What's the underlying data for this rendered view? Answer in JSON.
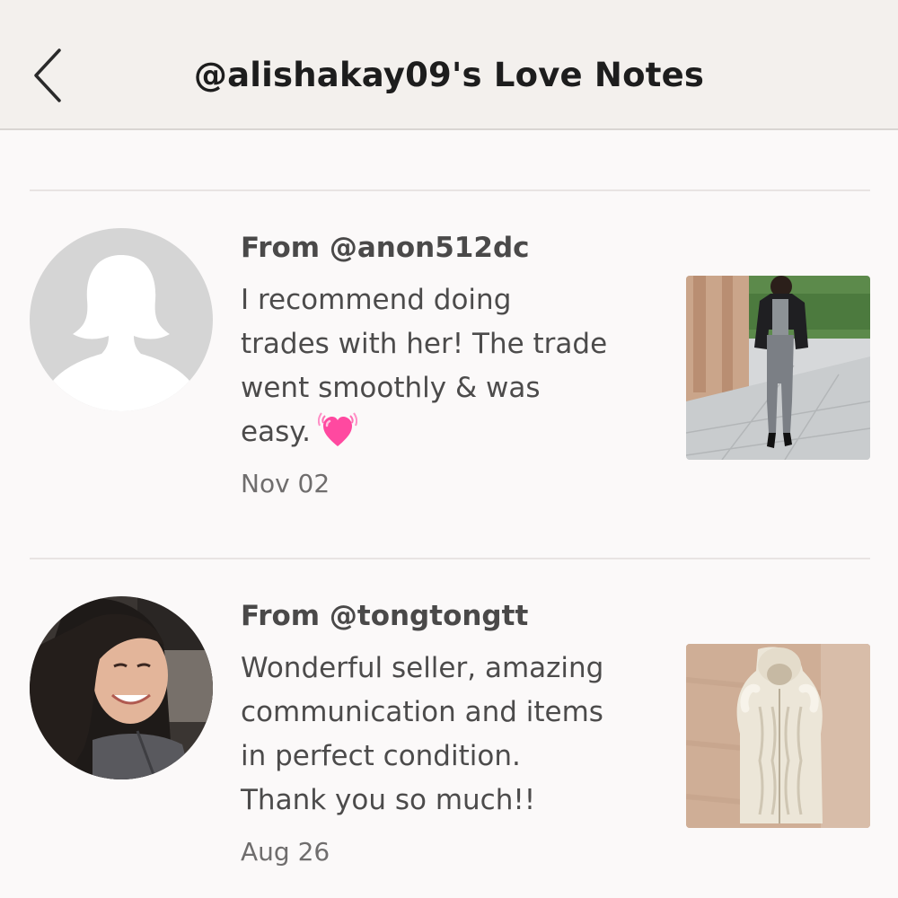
{
  "header": {
    "title": "@alishakay09's Love Notes"
  },
  "notes": [
    {
      "from": "From @anon512dc",
      "lines": [
        "I recommend doing",
        "trades with her! The trade",
        "went smoothly & was",
        "easy."
      ],
      "emoji": "growing-heart-icon",
      "date": "Nov 02"
    },
    {
      "from": "From @tongtongtt",
      "lines": [
        "Wonderful seller, amazing",
        "communication and items",
        "in perfect condition.",
        "Thank you so much!!"
      ],
      "date": "Aug 26"
    }
  ],
  "colors": {
    "header_bg": "#f3f0ed",
    "page_bg": "#fbf9f9",
    "text_dark": "#1d1d1d",
    "text_body": "#4c4b4b",
    "heart_pink": "#ff4fa3"
  }
}
